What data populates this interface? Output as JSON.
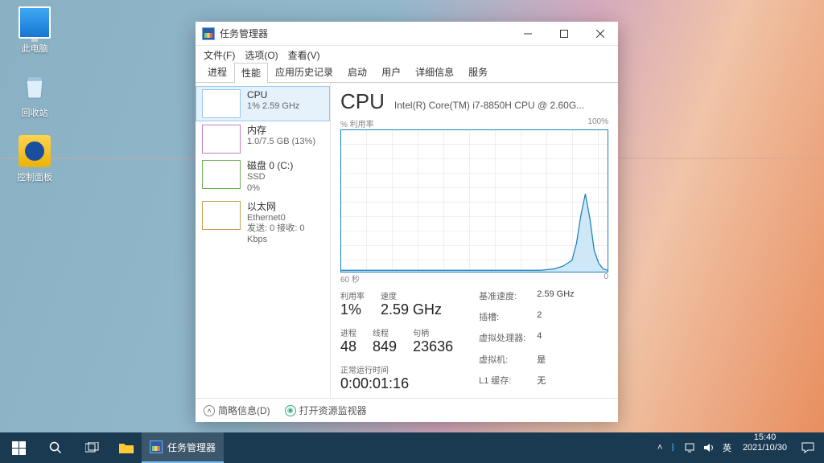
{
  "desktop": {
    "pc": "此电脑",
    "recycle": "回收站",
    "cpanel": "控制面板"
  },
  "window": {
    "title": "任务管理器",
    "menu": {
      "file": "文件(F)",
      "options": "选项(O)",
      "view": "查看(V)"
    },
    "tabs": [
      "进程",
      "性能",
      "应用历史记录",
      "启动",
      "用户",
      "详细信息",
      "服务"
    ],
    "activeTab": 1
  },
  "side": [
    {
      "title": "CPU",
      "sub": "1%  2.59 GHz"
    },
    {
      "title": "内存",
      "sub": "1.0/7.5 GB (13%)"
    },
    {
      "title": "磁盘 0 (C:)",
      "sub": "SSD",
      "sub2": "0%"
    },
    {
      "title": "以太网",
      "sub": "Ethernet0",
      "sub2": "发送: 0 接收: 0 Kbps"
    }
  ],
  "cpu": {
    "heading": "CPU",
    "model": "Intel(R) Core(TM) i7-8850H CPU @ 2.60G...",
    "axis_top_left": "% 利用率",
    "axis_top_right": "100%",
    "axis_bottom_left": "60 秒",
    "axis_bottom_right": "0",
    "util_label": "利用率",
    "util": "1%",
    "speed_label": "速度",
    "speed": "2.59 GHz",
    "proc_label": "进程",
    "proc": "48",
    "thread_label": "线程",
    "thread": "849",
    "handle_label": "句柄",
    "handle": "23636",
    "uptime_label": "正常运行时间",
    "uptime": "0:00:01:16",
    "kv": {
      "base_label": "基准速度:",
      "base": "2.59 GHz",
      "sockets_label": "插槽:",
      "sockets": "2",
      "vproc_label": "虚拟处理器:",
      "vproc": "4",
      "vm_label": "虚拟机:",
      "vm": "是",
      "l1_label": "L1 缓存:",
      "l1": "无"
    }
  },
  "footer": {
    "brief": "简略信息(D)",
    "resmon": "打开资源监视器"
  },
  "taskbar": {
    "task": "任务管理器",
    "ime": "英",
    "time": "15:40",
    "date": "2021/10/30"
  },
  "chart_data": {
    "type": "line",
    "title": "CPU % 利用率",
    "xlabel": "秒",
    "ylabel": "%",
    "xlim": [
      0,
      60
    ],
    "ylim": [
      0,
      100
    ],
    "x": [
      0,
      5,
      10,
      15,
      20,
      25,
      30,
      35,
      40,
      45,
      48,
      50,
      52,
      53,
      54,
      55,
      56,
      57,
      58,
      59,
      60
    ],
    "values": [
      1,
      1,
      1,
      1,
      1,
      1,
      1,
      1,
      1,
      1,
      2,
      4,
      8,
      20,
      40,
      55,
      38,
      15,
      6,
      2,
      1
    ]
  }
}
